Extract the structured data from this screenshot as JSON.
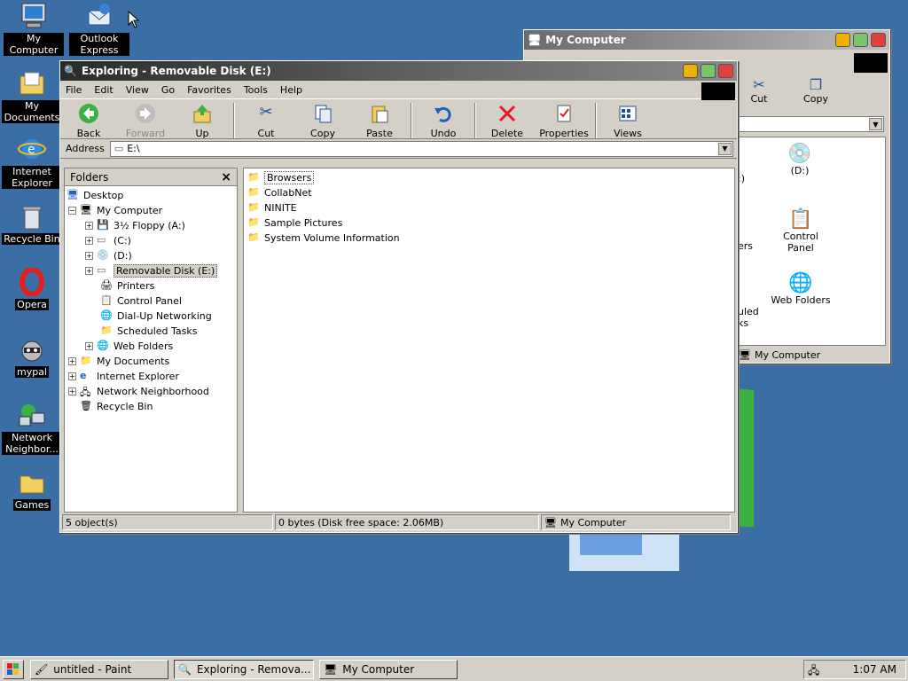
{
  "desktop": {
    "icons": [
      {
        "label": "My Computer"
      },
      {
        "label": "Outlook Express"
      },
      {
        "label": "My Documents"
      },
      {
        "label": "Internet Explorer"
      },
      {
        "label": "Recycle Bin"
      },
      {
        "label": "Opera"
      },
      {
        "label": "mypal"
      },
      {
        "label": "Network Neighbor..."
      },
      {
        "label": "Games"
      }
    ]
  },
  "explorer": {
    "title": "Exploring - Removable Disk (E:)",
    "menu": [
      "File",
      "Edit",
      "View",
      "Go",
      "Favorites",
      "Tools",
      "Help"
    ],
    "toolbar": {
      "back": "Back",
      "forward": "Forward",
      "up": "Up",
      "cut": "Cut",
      "copy": "Copy",
      "paste": "Paste",
      "undo": "Undo",
      "delete": "Delete",
      "properties": "Properties",
      "views": "Views"
    },
    "address_label": "Address",
    "address_value": "E:\\",
    "folders_header": "Folders",
    "folders_close": "×",
    "tree": {
      "desktop": "Desktop",
      "my_computer": "My Computer",
      "floppy": "3½ Floppy (A:)",
      "c": "(C:)",
      "d": "(D:)",
      "e": "Removable Disk (E:)",
      "printers": "Printers",
      "control_panel": "Control Panel",
      "dialup": "Dial-Up Networking",
      "scheduled": "Scheduled Tasks",
      "web_folders": "Web Folders",
      "my_documents": "My Documents",
      "ie": "Internet Explorer",
      "network": "Network Neighborhood",
      "recycle": "Recycle Bin"
    },
    "files": [
      "Browsers",
      "CollabNet",
      "NINITE",
      "Sample Pictures",
      "System Volume Information"
    ],
    "status": {
      "objects": "5 object(s)",
      "bytes": "0 bytes (Disk free space: 2.06MB)",
      "location": "My Computer"
    }
  },
  "mycomputer": {
    "title": "My Computer",
    "toolbar": {
      "cut": "Cut",
      "copy": "Copy"
    },
    "items": {
      "d_partial": ":)",
      "d": "(D:)",
      "partial2": "ers",
      "control_panel": "Control Panel",
      "partial3": "uled",
      "partial3b": "ks",
      "web_folders": "Web Folders"
    },
    "status": "My Computer"
  },
  "taskbar": {
    "tasks": [
      "untitled - Paint",
      "Exploring - Remova...",
      "My Computer"
    ],
    "clock": "1:07 AM"
  },
  "colors": {
    "desktop": "#3a6ea5",
    "window": "#d4d0c8",
    "accent_green": "#3cb043"
  }
}
